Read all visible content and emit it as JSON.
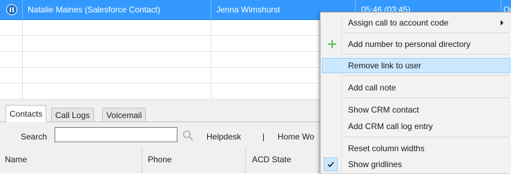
{
  "calls": {
    "selected_row": {
      "contact": "Natalie Maines (Salesforce Contact)",
      "agent": "Jenna Wimshurst",
      "duration": "05:46 (03:45)",
      "extra": "Or"
    }
  },
  "tabs": [
    "Contacts",
    "Call Logs",
    "Voicemail"
  ],
  "search": {
    "label": "Search",
    "value": "",
    "placeholder": ""
  },
  "filters": {
    "helpdesk": "Helpdesk",
    "separator": "|",
    "home": "Home Wo"
  },
  "columns": {
    "name": "Name",
    "phone": "Phone",
    "acd_state": "ACD State"
  },
  "context_menu": {
    "items": [
      "Assign call to account code",
      "Add number to personal directory",
      "Remove link to user",
      "Add call note",
      "Show CRM contact",
      "Add CRM call log entry",
      "Reset column widths",
      "Show gridlines"
    ],
    "highlighted": "Remove link to user",
    "checked": "Show gridlines"
  },
  "icons": {
    "hold": "pause-icon",
    "search": "search-icon",
    "add": "plus-icon",
    "submenu": "chevron-right-icon",
    "check": "check-icon"
  },
  "colors": {
    "selection": "#3399ff",
    "menu_highlight": "#cce8ff",
    "add_icon": "#55c155"
  }
}
